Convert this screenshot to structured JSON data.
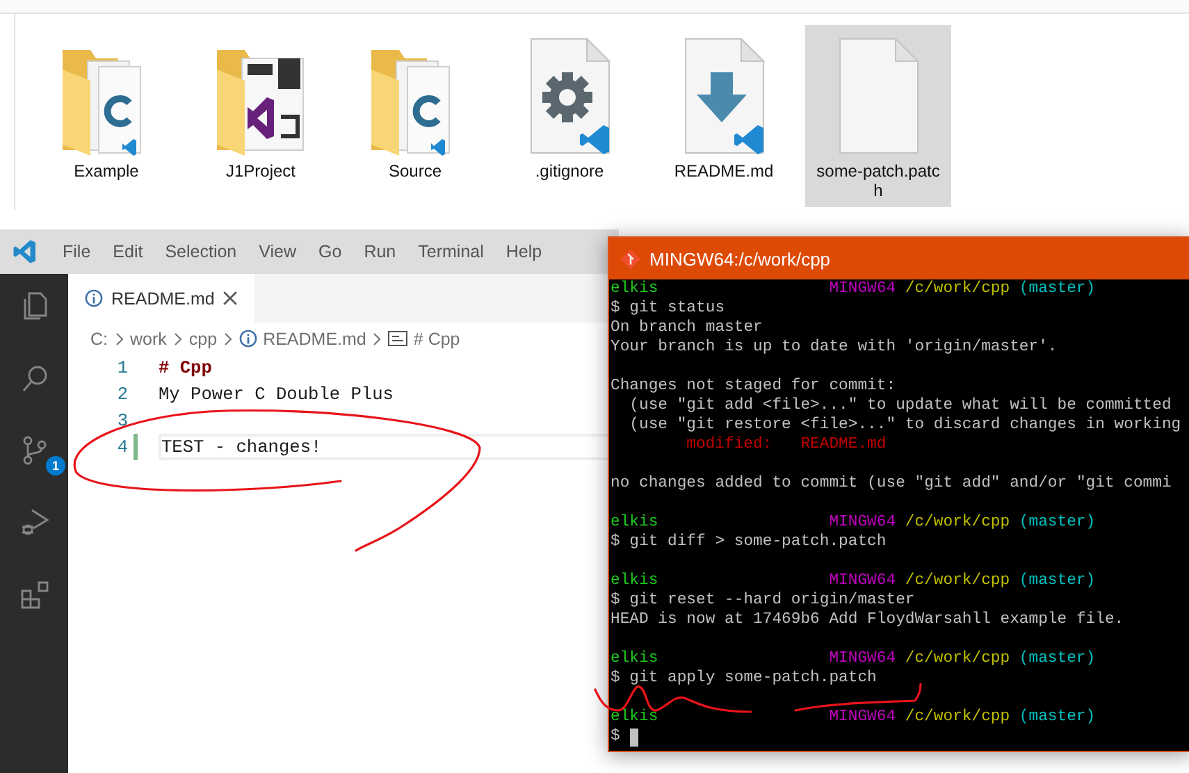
{
  "explorer": {
    "items": [
      {
        "label": "Example",
        "kind": "cpp-folder",
        "selected": false
      },
      {
        "label": "J1Project",
        "kind": "vs-folder",
        "selected": false
      },
      {
        "label": "Source",
        "kind": "cpp-folder",
        "selected": false
      },
      {
        "label": ".gitignore",
        "kind": "settings-file",
        "selected": false
      },
      {
        "label": "README.md",
        "kind": "download-file",
        "selected": false
      },
      {
        "label": "some-patch.patch",
        "kind": "blank-file",
        "selected": true
      }
    ]
  },
  "editor": {
    "menu": [
      "File",
      "Edit",
      "Selection",
      "View",
      "Go",
      "Run",
      "Terminal",
      "Help"
    ],
    "activity_bar": [
      {
        "kind": "files"
      },
      {
        "kind": "search"
      },
      {
        "kind": "source-control",
        "badge": "1"
      },
      {
        "kind": "debug"
      },
      {
        "kind": "extensions"
      }
    ],
    "tabs": [
      {
        "label": "README.md",
        "selected": true
      }
    ],
    "breadcrumbs": [
      {
        "label": "C:",
        "kind": "text"
      },
      {
        "label": "work",
        "kind": "text"
      },
      {
        "label": "cpp",
        "kind": "text"
      },
      {
        "label": "README.md",
        "kind": "file"
      },
      {
        "label": "# Cpp",
        "kind": "symbol"
      }
    ],
    "lines": [
      {
        "number": "1",
        "text": "# Cpp",
        "kind": "heading",
        "modified": false,
        "current": false
      },
      {
        "number": "2",
        "text": "My Power C Double Plus",
        "kind": "text",
        "modified": false,
        "current": false
      },
      {
        "number": "3",
        "kind": "text",
        "modified": false,
        "current": false
      },
      {
        "number": "4",
        "text": "TEST - changes!",
        "kind": "text",
        "modified": true,
        "current": true
      }
    ]
  },
  "terminal": {
    "title": "MINGW64:/c/work/cpp",
    "lines": [
      {
        "kind": "prompt",
        "user": "elkis",
        "system": "MINGW64",
        "path": "/c/work/cpp",
        "branch": "(master)"
      },
      {
        "kind": "command",
        "text": "$ git status",
        "cursor": false
      },
      {
        "kind": "output",
        "text": "On branch master"
      },
      {
        "kind": "output",
        "text": "Your branch is up to date with 'origin/master'."
      },
      {
        "kind": "blank"
      },
      {
        "kind": "output",
        "text": "Changes not staged for commit:"
      },
      {
        "kind": "output",
        "text": "  (use \"git add <file>...\" to update what will be committed"
      },
      {
        "kind": "output",
        "text": "  (use \"git restore <file>...\" to discard changes in working"
      },
      {
        "kind": "modified",
        "label": "modified:",
        "file": "README.md"
      },
      {
        "kind": "blank"
      },
      {
        "kind": "output",
        "text": "no changes added to commit (use \"git add\" and/or \"git commi"
      },
      {
        "kind": "blank"
      },
      {
        "kind": "prompt",
        "user": "elkis",
        "system": "MINGW64",
        "path": "/c/work/cpp",
        "branch": "(master)"
      },
      {
        "kind": "command",
        "text": "$ git diff > some-patch.patch",
        "cursor": false
      },
      {
        "kind": "blank"
      },
      {
        "kind": "prompt",
        "user": "elkis",
        "system": "MINGW64",
        "path": "/c/work/cpp",
        "branch": "(master)"
      },
      {
        "kind": "command",
        "text": "$ git reset --hard origin/master",
        "cursor": false
      },
      {
        "kind": "output",
        "text": "HEAD is now at 17469b6 Add FloydWarsahll example file."
      },
      {
        "kind": "blank"
      },
      {
        "kind": "prompt",
        "user": "elkis",
        "system": "MINGW64",
        "path": "/c/work/cpp",
        "branch": "(master)"
      },
      {
        "kind": "command",
        "text": "$ git apply some-patch.patch",
        "cursor": false
      },
      {
        "kind": "blank"
      },
      {
        "kind": "prompt",
        "user": "elkis",
        "system": "MINGW64",
        "path": "/c/work/cpp",
        "branch": "(master)"
      },
      {
        "kind": "command",
        "text": "$",
        "cursor": true
      }
    ]
  }
}
